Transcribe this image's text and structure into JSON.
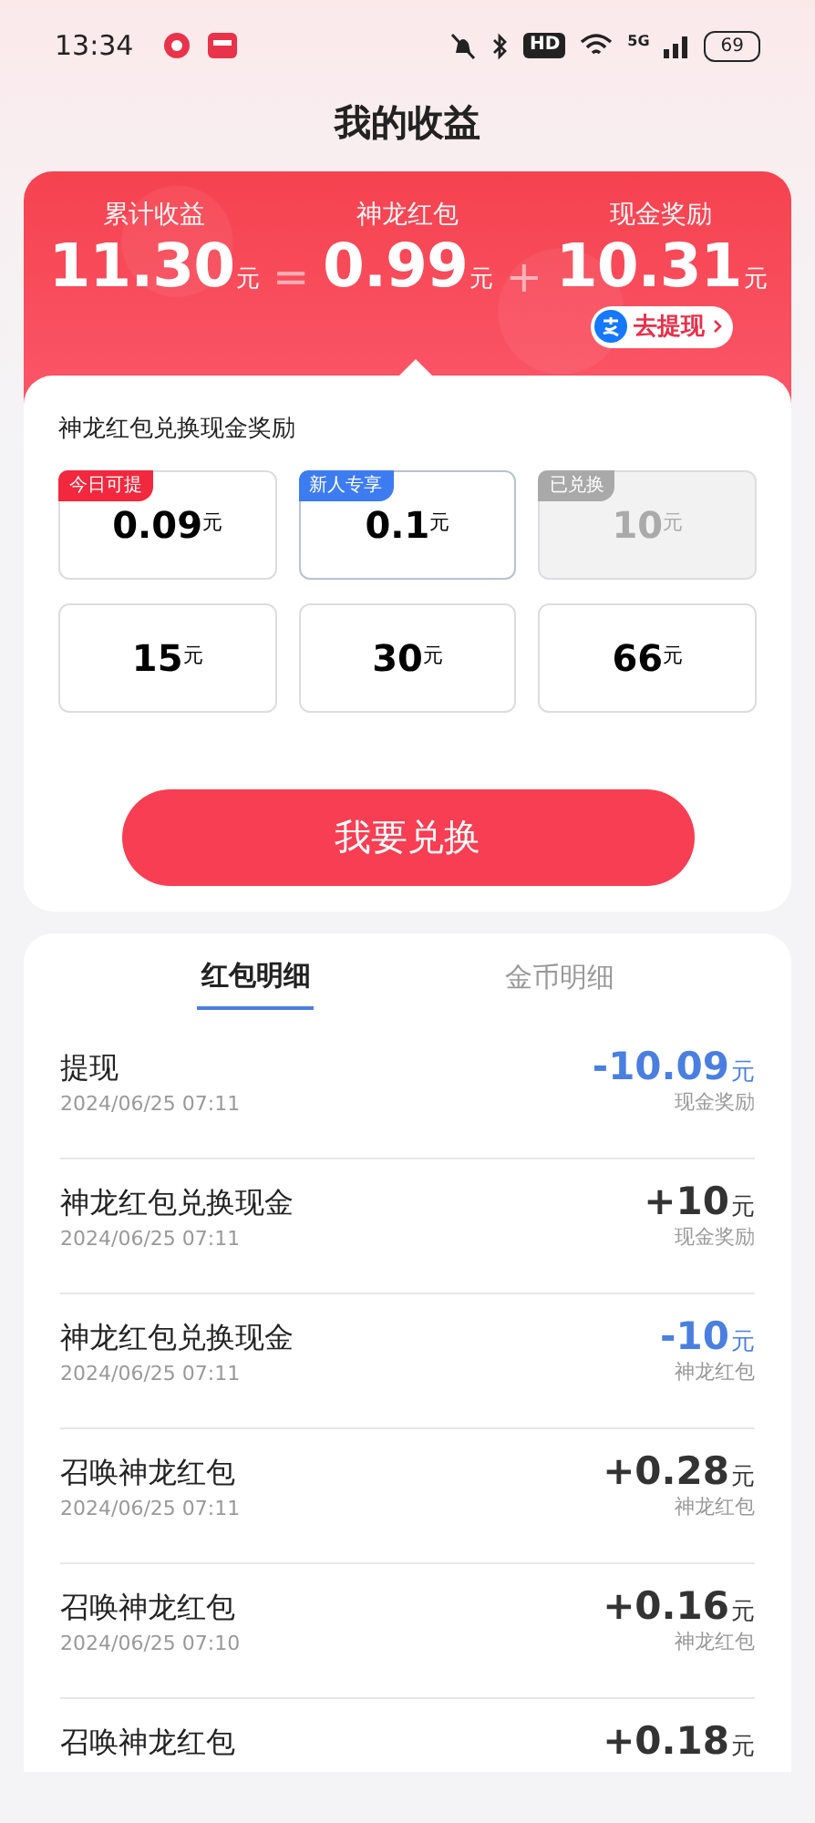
{
  "status_bar": {
    "time": "13:34",
    "hd": "HD",
    "network": "5G",
    "battery": "69"
  },
  "title": "我的收益",
  "summary": {
    "items": [
      {
        "label": "累计收益",
        "value": "11.30",
        "unit": "元"
      },
      {
        "operator": "="
      },
      {
        "label": "神龙红包",
        "value": "0.99",
        "unit": "元"
      },
      {
        "operator": "+"
      },
      {
        "label": "现金奖励",
        "value": "10.31",
        "unit": "元"
      }
    ],
    "withdraw": "去提现"
  },
  "exchange": {
    "title": "神龙红包兑换现金奖励",
    "options": [
      {
        "tag": {
          "label": "今日可提",
          "color": "#f2283e"
        },
        "value": "0.09",
        "unit": "元",
        "selected": false,
        "disabled": false
      },
      {
        "tag": {
          "label": "新人专享",
          "color": "#3d7cf0"
        },
        "value": "0.1",
        "unit": "元",
        "selected": true,
        "disabled": false
      },
      {
        "tag": {
          "label": "已兑换",
          "color": "#a9a9a9"
        },
        "value": "10",
        "unit": "元",
        "selected": false,
        "disabled": true
      },
      {
        "value": "15",
        "unit": "元",
        "selected": false,
        "disabled": false
      },
      {
        "value": "30",
        "unit": "元",
        "selected": false,
        "disabled": false
      },
      {
        "value": "66",
        "unit": "元",
        "selected": false,
        "disabled": false
      }
    ],
    "button": "我要兑换"
  },
  "details": {
    "tabs": [
      {
        "label": "红包明细",
        "selected": true
      },
      {
        "label": "金币明细",
        "selected": false
      }
    ],
    "rows": [
      {
        "title": "提现",
        "time": "2024/06/25 07:11",
        "amount": "-10.09",
        "unit": "元",
        "color": "#4a7fe0",
        "account": "现金奖励"
      },
      {
        "title": "神龙红包兑换现金",
        "time": "2024/06/25 07:11",
        "amount": "+10",
        "unit": "元",
        "color": "#333333",
        "account": "现金奖励"
      },
      {
        "title": "神龙红包兑换现金",
        "time": "2024/06/25 07:11",
        "amount": "-10",
        "unit": "元",
        "color": "#4a7fe0",
        "account": "神龙红包"
      },
      {
        "title": "召唤神龙红包",
        "time": "2024/06/25 07:11",
        "amount": "+0.28",
        "unit": "元",
        "color": "#333333",
        "account": "神龙红包"
      },
      {
        "title": "召唤神龙红包",
        "time": "2024/06/25 07:10",
        "amount": "+0.16",
        "unit": "元",
        "color": "#333333",
        "account": "神龙红包"
      },
      {
        "title": "召唤神龙红包",
        "amount": "+0.18",
        "unit": "元",
        "color": "#333333"
      }
    ]
  }
}
